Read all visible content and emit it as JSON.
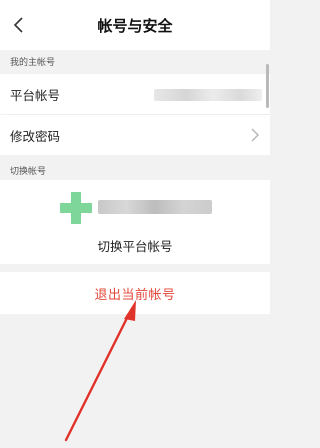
{
  "header": {
    "title": "帐号与安全",
    "back_icon": "chevron-left-icon"
  },
  "main_account": {
    "section_label": "我的主帐号",
    "items": [
      {
        "label": "平台帐号"
      },
      {
        "label": "修改密码"
      }
    ]
  },
  "switch_account": {
    "section_label": "切换帐号",
    "switch_label": "切换平台帐号"
  },
  "logout": {
    "label": "退出当前帐号"
  },
  "colors": {
    "danger": "#e5493a",
    "annotation_arrow": "#e0332a",
    "avatar": "#7fd69a"
  }
}
